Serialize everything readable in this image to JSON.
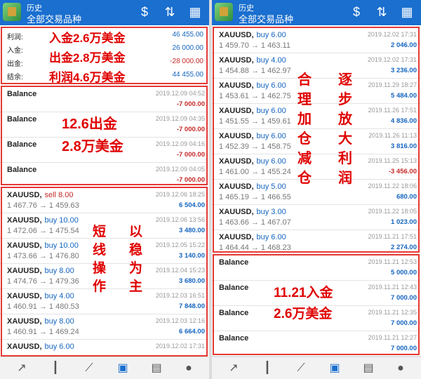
{
  "left": {
    "header": {
      "subtitle": "历史",
      "title": "全部交易品种",
      "icons": [
        "currency-exchange-icon",
        "sort-icon",
        "calendar-icon"
      ]
    },
    "summary": [
      {
        "label": "利润:",
        "value": "46 455.00",
        "negative": false
      },
      {
        "label": "入金:",
        "value": "26 000.00",
        "negative": false
      },
      {
        "label": "出金:",
        "value": "-28 000.00",
        "negative": true
      },
      {
        "label": "结余:",
        "value": "44 455.00",
        "negative": false
      }
    ],
    "summary_annotations": [
      "入金2.6万美金",
      "出金2.8万美金",
      "利润4.6万美金"
    ],
    "balances": [
      {
        "label": "Balance",
        "date": "2019.12.09 04:52",
        "amount": "-7 000.00"
      },
      {
        "label": "Balance",
        "date": "2019.12.09 04:35",
        "amount": "-7 000.00"
      },
      {
        "label": "Balance",
        "date": "2019.12.09 04:16",
        "amount": "-7 000.00"
      },
      {
        "label": "Balance",
        "date": "2019.12.09 04:05",
        "amount": "-7 000.00"
      }
    ],
    "balance_annotation": [
      "12.6出金",
      "2.8万美金"
    ],
    "trades": [
      {
        "symbol": "XAUUSD,",
        "action": "sell 8.00",
        "sell": true,
        "prices": "1 467.76 → 1 459.63",
        "date": "2019.12.06 18:25",
        "profit": "6 504.00"
      },
      {
        "symbol": "XAUUSD,",
        "action": "buy 10.00",
        "sell": false,
        "prices": "1 472.06 → 1 475.54",
        "date": "2019.12.06 13:56",
        "profit": "3 480.00"
      },
      {
        "symbol": "XAUUSD,",
        "action": "buy 10.00",
        "sell": false,
        "prices": "1 473.66 → 1 476.80",
        "date": "2019.12.05 15:22",
        "profit": "3 140.00"
      },
      {
        "symbol": "XAUUSD,",
        "action": "buy 8.00",
        "sell": false,
        "prices": "1 474.76 → 1 479.36",
        "date": "2019.12.04 15:23",
        "profit": "3 680.00"
      },
      {
        "symbol": "XAUUSD,",
        "action": "buy 4.00",
        "sell": false,
        "prices": "1 460.91 → 1 480.53",
        "date": "2019.12.03 16:51",
        "profit": "7 848.00"
      },
      {
        "symbol": "XAUUSD,",
        "action": "buy 8.00",
        "sell": false,
        "prices": "1 460.91 → 1 469.24",
        "date": "2019.12.03 12:16",
        "profit": "6 664.00"
      },
      {
        "symbol": "XAUUSD,",
        "action": "buy 6.00",
        "sell": false,
        "prices": "",
        "date": "2019.12.02 17:31",
        "profit": ""
      }
    ],
    "trade_annotation_cols": [
      "短线操作",
      "以稳为主"
    ]
  },
  "right": {
    "header": {
      "subtitle": "历史",
      "title": "全部交易品种",
      "icons": [
        "currency-exchange-icon",
        "sort-icon",
        "calendar-icon"
      ]
    },
    "trades": [
      {
        "symbol": "XAUUSD,",
        "action": "buy 6.00",
        "sell": false,
        "prices": "1 459.70 → 1 463.11",
        "date": "2019.12.02 17:31",
        "profit": "2 046.00",
        "negative": false
      },
      {
        "symbol": "XAUUSD,",
        "action": "buy 4.00",
        "sell": false,
        "prices": "1 454.88 → 1 462.97",
        "date": "2019.12.02 17:31",
        "profit": "3 236.00",
        "negative": false
      },
      {
        "symbol": "XAUUSD,",
        "action": "buy 6.00",
        "sell": false,
        "prices": "1 453.61 → 1 462.75",
        "date": "2019.11.29 18:27",
        "profit": "5 484.00",
        "negative": false
      },
      {
        "symbol": "XAUUSD,",
        "action": "buy 6.00",
        "sell": false,
        "prices": "1 451.55 → 1 459.61",
        "date": "2019.11.26 17:51",
        "profit": "4 836.00",
        "negative": false
      },
      {
        "symbol": "XAUUSD,",
        "action": "buy 6.00",
        "sell": false,
        "prices": "1 452.39 → 1 458.75",
        "date": "2019.11.26 11:13",
        "profit": "3 816.00",
        "negative": false
      },
      {
        "symbol": "XAUUSD,",
        "action": "buy 6.00",
        "sell": false,
        "prices": "1 461.00 → 1 455.24",
        "date": "2019.11.25 15:13",
        "profit": "-3 456.00",
        "negative": true
      },
      {
        "symbol": "XAUUSD,",
        "action": "buy 5.00",
        "sell": false,
        "prices": "1 465.19 → 1 466.55",
        "date": "2019.11.22 18:06",
        "profit": "680.00",
        "negative": false
      },
      {
        "symbol": "XAUUSD,",
        "action": "buy 3.00",
        "sell": false,
        "prices": "1 463.66 → 1 467.07",
        "date": "2019.11.22 18:05",
        "profit": "1 023.00",
        "negative": false
      },
      {
        "symbol": "XAUUSD,",
        "action": "buy 6.00",
        "sell": false,
        "prices": "1 464.44 → 1 468.23",
        "date": "2019.11.21 17:51",
        "profit": "2 274.00",
        "negative": false
      }
    ],
    "trade_annotation_cols": [
      "合理加仓减仓",
      "逐步放大利润"
    ],
    "balances": [
      {
        "label": "Balance",
        "date": "2019.11.21 12:53",
        "amount": "5 000.00"
      },
      {
        "label": "Balance",
        "date": "2019.11.21 12:43",
        "amount": "7 000.00"
      },
      {
        "label": "Balance",
        "date": "2019.11.21 12:35",
        "amount": "7 000.00"
      },
      {
        "label": "Balance",
        "date": "2019.11.21 12:27",
        "amount": "7 000.00"
      }
    ],
    "balance_annotation": [
      "11.21入金",
      "2.6万美金"
    ]
  },
  "nav_icons": [
    "trade-icon",
    "candlestick-icon",
    "chart-icon",
    "history-icon",
    "news-icon",
    "chat-icon"
  ],
  "colors": {
    "header": "#1a6fcf",
    "profit": "#1565c0",
    "loss": "#c62828",
    "annotation": "#e00000",
    "frame": "#e53935"
  }
}
